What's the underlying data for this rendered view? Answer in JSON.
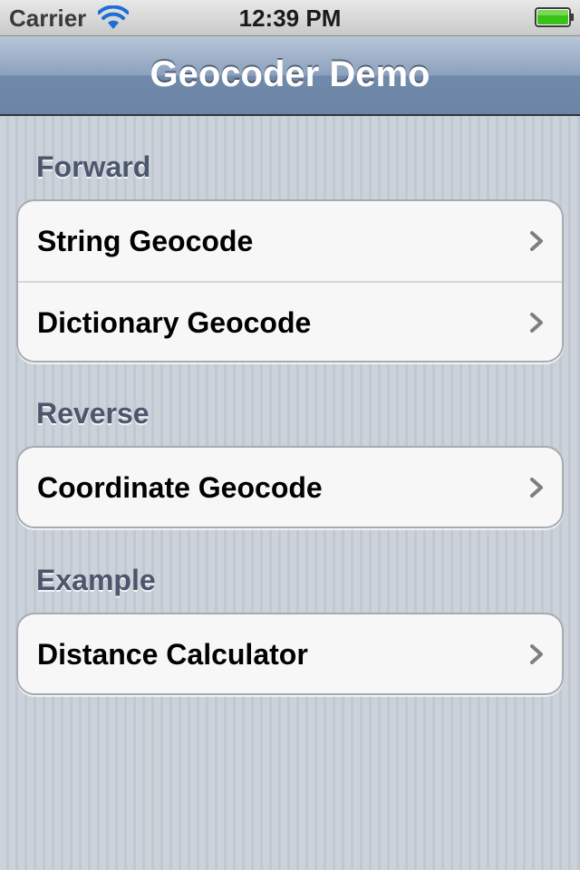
{
  "status_bar": {
    "carrier": "Carrier",
    "time": "12:39 PM",
    "wifi_icon": "wifi-icon",
    "battery_icon": "battery-full-icon",
    "battery_color": "#3cc01a"
  },
  "nav_bar": {
    "title": "Geocoder Demo"
  },
  "sections": [
    {
      "header": "Forward",
      "items": [
        {
          "label": "String Geocode",
          "icon": "chevron-right-icon"
        },
        {
          "label": "Dictionary Geocode",
          "icon": "chevron-right-icon"
        }
      ]
    },
    {
      "header": "Reverse",
      "items": [
        {
          "label": "Coordinate Geocode",
          "icon": "chevron-right-icon"
        }
      ]
    },
    {
      "header": "Example",
      "items": [
        {
          "label": "Distance Calculator",
          "icon": "chevron-right-icon"
        }
      ]
    }
  ]
}
